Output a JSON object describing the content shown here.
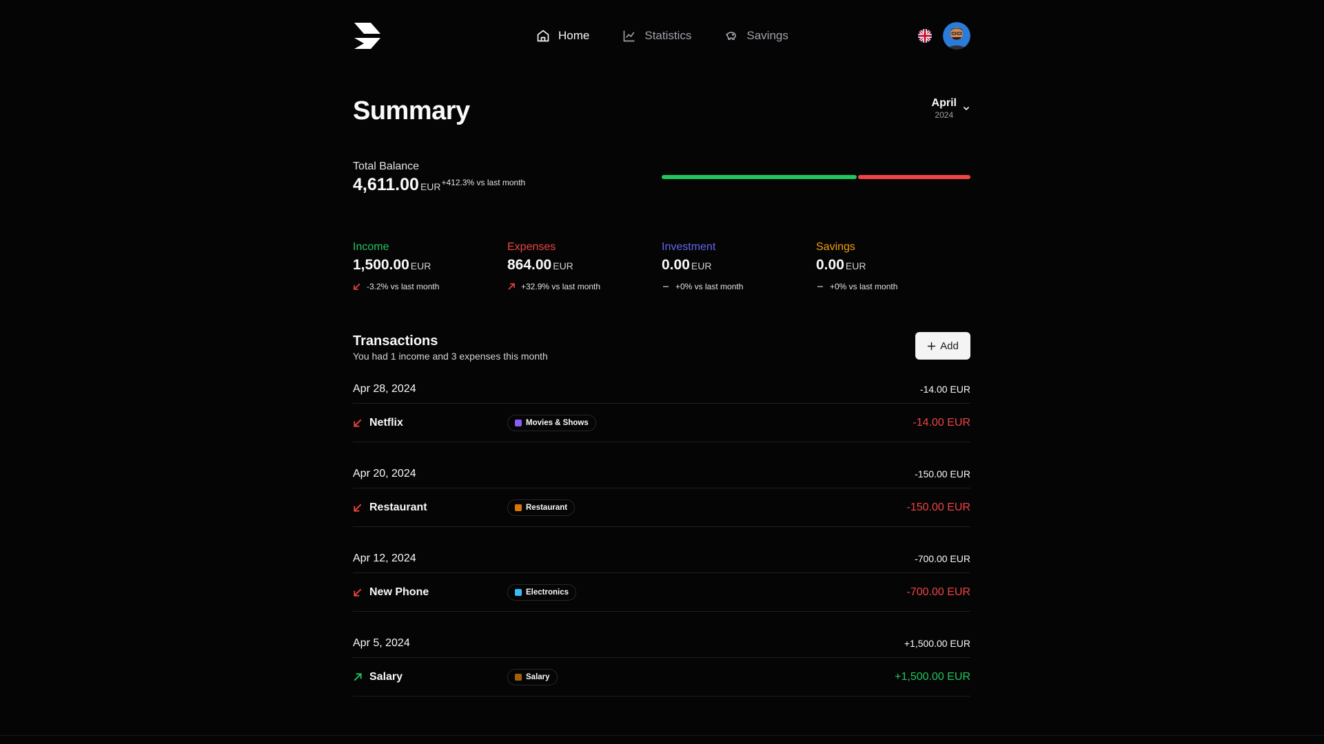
{
  "nav": {
    "items": [
      {
        "label": "Home",
        "icon": "home-icon",
        "active": true
      },
      {
        "label": "Statistics",
        "icon": "chart-line-icon",
        "active": false
      },
      {
        "label": "Savings",
        "icon": "piggy-bank-icon",
        "active": false
      }
    ]
  },
  "header": {
    "language_icon": "uk-flag-icon",
    "avatar_icon": "user-avatar"
  },
  "summary": {
    "title": "Summary",
    "month": "April",
    "year": "2024",
    "total_balance_label": "Total Balance",
    "total_balance_value": "4,611.00",
    "total_balance_currency": "EUR",
    "total_balance_delta": "+412.3% vs last month",
    "balance_bar": {
      "income_share": 0.634,
      "expenses_share": 0.366,
      "income_color": "#22c55e",
      "expenses_color": "#ef4444"
    }
  },
  "stats": [
    {
      "label": "Income",
      "value": "1,500.00",
      "currency": "EUR",
      "delta": "-3.2% vs last month",
      "trend": "down",
      "color": "#22c55e",
      "icon_color": "#ef4444"
    },
    {
      "label": "Expenses",
      "value": "864.00",
      "currency": "EUR",
      "delta": "+32.9% vs last month",
      "trend": "up",
      "color": "#ef4444",
      "icon_color": "#ef4444"
    },
    {
      "label": "Investment",
      "value": "0.00",
      "currency": "EUR",
      "delta": "+0% vs last month",
      "trend": "flat",
      "color": "#6366f1",
      "icon_color": "#a1a1aa"
    },
    {
      "label": "Savings",
      "value": "0.00",
      "currency": "EUR",
      "delta": "+0% vs last month",
      "trend": "flat",
      "color": "#f59e0b",
      "icon_color": "#a1a1aa"
    }
  ],
  "transactions": {
    "title": "Transactions",
    "subtitle": "You had 1 income and 3 expenses this month",
    "add_label": "Add",
    "groups": [
      {
        "date": "Apr 28, 2024",
        "total": "-14.00 EUR",
        "items": [
          {
            "name": "Netflix",
            "category": "Movies & Shows",
            "category_icon": "clapper-icon",
            "category_color": "#8b5cf6",
            "amount": "-14.00 EUR",
            "type": "expense"
          }
        ]
      },
      {
        "date": "Apr 20, 2024",
        "total": "-150.00 EUR",
        "items": [
          {
            "name": "Restaurant",
            "category": "Restaurant",
            "category_icon": "burger-icon",
            "category_color": "#d97706",
            "amount": "-150.00 EUR",
            "type": "expense"
          }
        ]
      },
      {
        "date": "Apr 12, 2024",
        "total": "-700.00 EUR",
        "items": [
          {
            "name": "New Phone",
            "category": "Electronics",
            "category_icon": "laptop-icon",
            "category_color": "#38bdf8",
            "amount": "-700.00 EUR",
            "type": "expense"
          }
        ]
      },
      {
        "date": "Apr 5, 2024",
        "total": "+1,500.00 EUR",
        "items": [
          {
            "name": "Salary",
            "category": "Salary",
            "category_icon": "briefcase-icon",
            "category_color": "#a16207",
            "amount": "+1,500.00 EUR",
            "type": "income"
          }
        ]
      }
    ]
  }
}
